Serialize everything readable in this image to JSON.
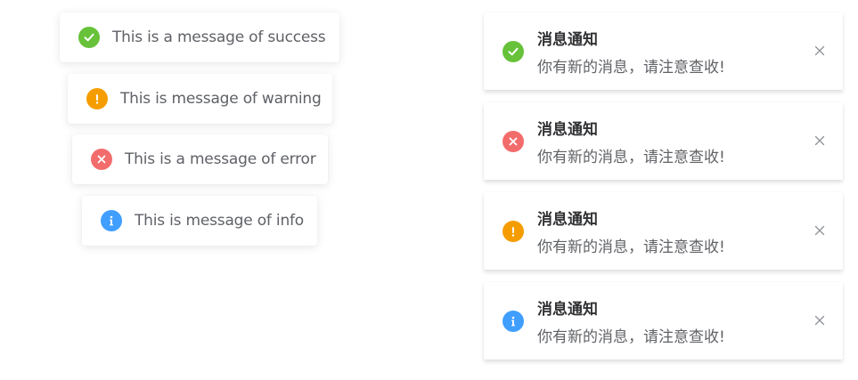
{
  "messages": [
    {
      "type": "success",
      "icon": "check-icon",
      "text": "This is a message of success"
    },
    {
      "type": "warning",
      "icon": "exclamation-icon",
      "text": "This is message of warning"
    },
    {
      "type": "error",
      "icon": "cross-icon",
      "text": "This is a message of error"
    },
    {
      "type": "info",
      "icon": "info-icon",
      "text": "This is message of info"
    }
  ],
  "notifications": [
    {
      "type": "success",
      "icon": "check-icon",
      "title": "消息通知",
      "body": "你有新的消息，请注意查收!",
      "close_icon": "close-icon"
    },
    {
      "type": "error",
      "icon": "cross-icon",
      "title": "消息通知",
      "body": "你有新的消息，请注意查收!",
      "close_icon": "close-icon"
    },
    {
      "type": "warning",
      "icon": "exclamation-icon",
      "title": "消息通知",
      "body": "你有新的消息，请注意查收!",
      "close_icon": "close-icon"
    },
    {
      "type": "info",
      "icon": "info-icon",
      "title": "消息通知",
      "body": "你有新的消息，请注意查收!",
      "close_icon": "close-icon"
    }
  ],
  "colors": {
    "success": "#67c23a",
    "warning": "#f59d00",
    "error": "#f36c6c",
    "info": "#409eff",
    "text": "#606266",
    "title": "#303133",
    "close": "#909399"
  }
}
